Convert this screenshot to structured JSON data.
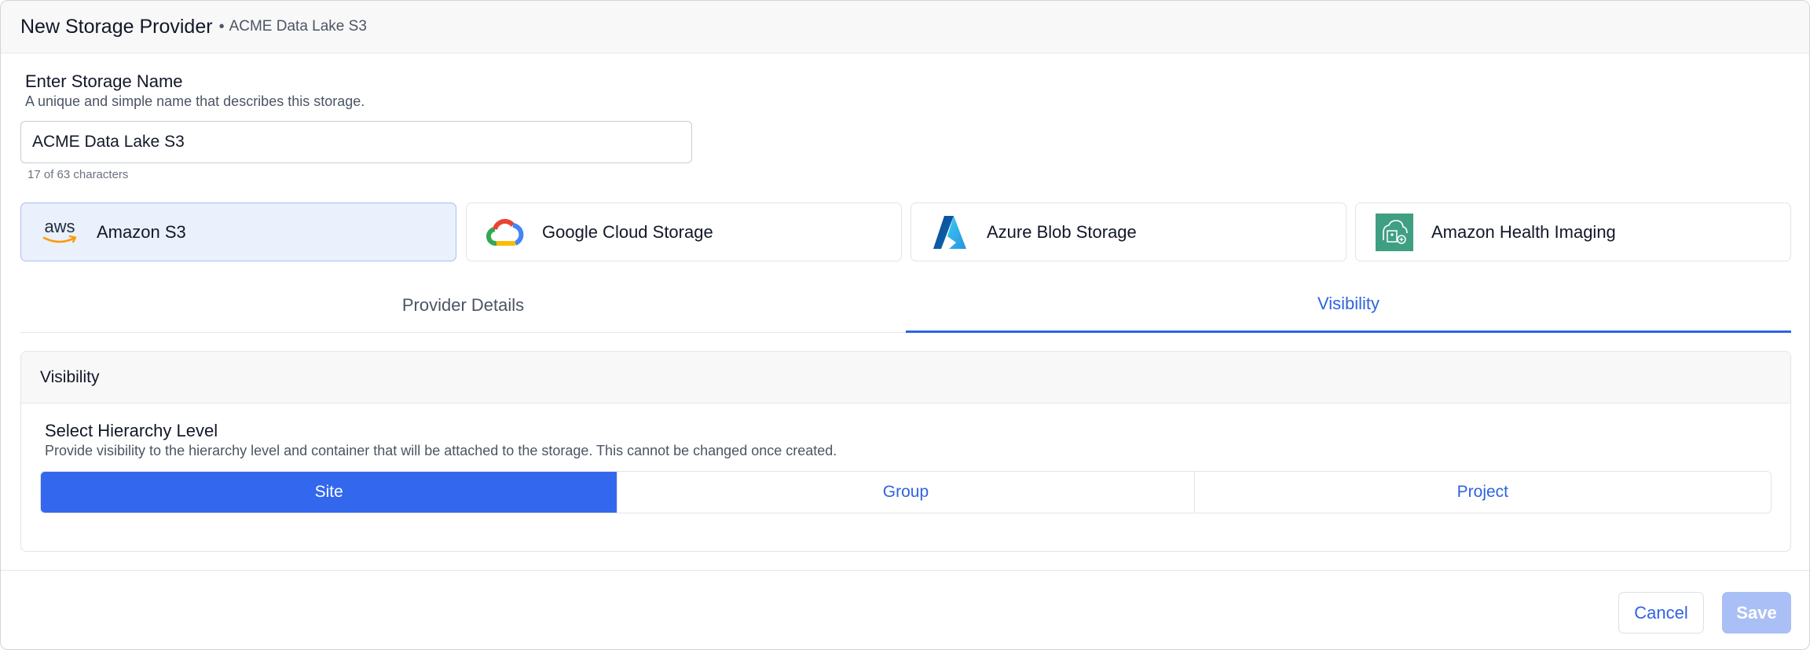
{
  "header": {
    "title": "New Storage Provider",
    "separator": "•",
    "subtitle": "ACME Data Lake S3"
  },
  "name_section": {
    "label": "Enter Storage Name",
    "help": "A unique and simple name that describes this storage.",
    "value": "ACME Data Lake S3",
    "char_count": "17 of 63 characters"
  },
  "providers": [
    {
      "name": "Amazon S3",
      "icon": "aws-logo-icon",
      "selected": true
    },
    {
      "name": "Google Cloud Storage",
      "icon": "google-cloud-logo-icon",
      "selected": false
    },
    {
      "name": "Azure Blob Storage",
      "icon": "azure-logo-icon",
      "selected": false
    },
    {
      "name": "Amazon Health Imaging",
      "icon": "health-imaging-logo-icon",
      "selected": false
    }
  ],
  "aws_logo_text": "aws",
  "tabs": [
    {
      "label": "Provider Details",
      "active": false
    },
    {
      "label": "Visibility",
      "active": true
    }
  ],
  "visibility": {
    "title": "Visibility",
    "hierarchy_label": "Select Hierarchy Level",
    "hierarchy_help": "Provide visibility to the hierarchy level and container that will be attached to the storage. This cannot be changed once created.",
    "options": [
      {
        "label": "Site",
        "active": true
      },
      {
        "label": "Group",
        "active": false
      },
      {
        "label": "Project",
        "active": false
      }
    ]
  },
  "footer": {
    "cancel_label": "Cancel",
    "save_label": "Save"
  },
  "colors": {
    "accent": "#3367ee",
    "link": "#2f63e0",
    "selected_bg": "#eaf0fc",
    "save_disabled": "#a9bff5"
  }
}
